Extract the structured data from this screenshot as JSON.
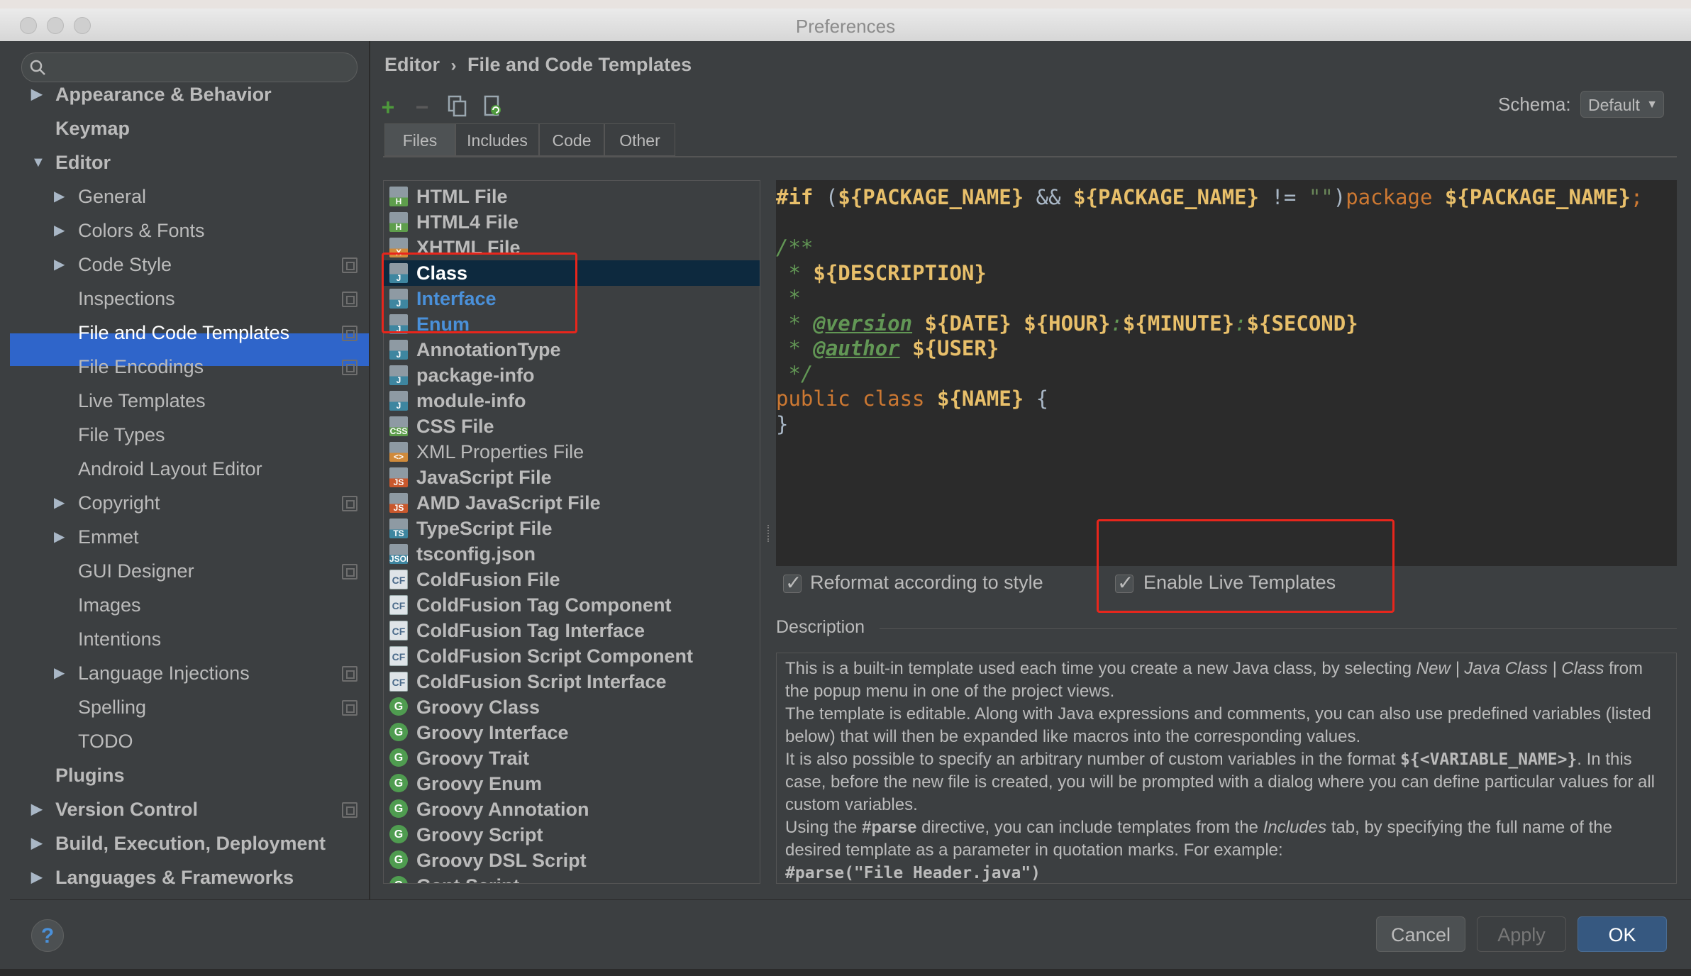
{
  "window": {
    "title": "Preferences"
  },
  "search": {
    "placeholder": ""
  },
  "sidebar": {
    "items": [
      {
        "label": "Appearance & Behavior",
        "level": 0,
        "bold": true,
        "arrow": "collapsed",
        "copy": false
      },
      {
        "label": "Keymap",
        "level": 0,
        "bold": true,
        "arrow": "none",
        "copy": false
      },
      {
        "label": "Editor",
        "level": 0,
        "bold": true,
        "arrow": "expanded",
        "copy": false
      },
      {
        "label": "General",
        "level": 1,
        "bold": false,
        "arrow": "collapsed",
        "copy": false
      },
      {
        "label": "Colors & Fonts",
        "level": 1,
        "bold": false,
        "arrow": "collapsed",
        "copy": false
      },
      {
        "label": "Code Style",
        "level": 1,
        "bold": false,
        "arrow": "collapsed",
        "copy": true
      },
      {
        "label": "Inspections",
        "level": 1,
        "bold": false,
        "arrow": "none",
        "copy": true
      },
      {
        "label": "File and Code Templates",
        "level": 1,
        "bold": false,
        "arrow": "none",
        "copy": true,
        "selected": true
      },
      {
        "label": "File Encodings",
        "level": 1,
        "bold": false,
        "arrow": "none",
        "copy": true
      },
      {
        "label": "Live Templates",
        "level": 1,
        "bold": false,
        "arrow": "none",
        "copy": false
      },
      {
        "label": "File Types",
        "level": 1,
        "bold": false,
        "arrow": "none",
        "copy": false
      },
      {
        "label": "Android Layout Editor",
        "level": 1,
        "bold": false,
        "arrow": "none",
        "copy": false
      },
      {
        "label": "Copyright",
        "level": 1,
        "bold": false,
        "arrow": "collapsed",
        "copy": true
      },
      {
        "label": "Emmet",
        "level": 1,
        "bold": false,
        "arrow": "collapsed",
        "copy": false
      },
      {
        "label": "GUI Designer",
        "level": 1,
        "bold": false,
        "arrow": "none",
        "copy": true
      },
      {
        "label": "Images",
        "level": 1,
        "bold": false,
        "arrow": "none",
        "copy": false
      },
      {
        "label": "Intentions",
        "level": 1,
        "bold": false,
        "arrow": "none",
        "copy": false
      },
      {
        "label": "Language Injections",
        "level": 1,
        "bold": false,
        "arrow": "collapsed",
        "copy": true
      },
      {
        "label": "Spelling",
        "level": 1,
        "bold": false,
        "arrow": "none",
        "copy": true
      },
      {
        "label": "TODO",
        "level": 1,
        "bold": false,
        "arrow": "none",
        "copy": false
      },
      {
        "label": "Plugins",
        "level": 0,
        "bold": true,
        "arrow": "none",
        "copy": false
      },
      {
        "label": "Version Control",
        "level": 0,
        "bold": true,
        "arrow": "collapsed",
        "copy": true
      },
      {
        "label": "Build, Execution, Deployment",
        "level": 0,
        "bold": true,
        "arrow": "collapsed",
        "copy": false
      },
      {
        "label": "Languages & Frameworks",
        "level": 0,
        "bold": true,
        "arrow": "collapsed",
        "copy": false
      }
    ]
  },
  "breadcrumb": {
    "parent": "Editor",
    "separator": "›",
    "current": "File and Code Templates"
  },
  "toolbar": {
    "add_icon": "plus-icon",
    "remove_icon": "minus-icon",
    "copy_icon": "copy-icon",
    "reset_icon": "reset-icon"
  },
  "schema": {
    "label": "Schema:",
    "value": "Default"
  },
  "tabs": [
    {
      "label": "Files",
      "active": true
    },
    {
      "label": "Includes",
      "active": false
    },
    {
      "label": "Code",
      "active": false
    },
    {
      "label": "Other",
      "active": false
    }
  ],
  "files": [
    {
      "label": "HTML File",
      "icon": "html-file-icon",
      "badge": "H",
      "color": "#5e9e4c"
    },
    {
      "label": "HTML4 File",
      "icon": "html-file-icon",
      "badge": "H",
      "color": "#5e9e4c"
    },
    {
      "label": "XHTML File",
      "icon": "xhtml-file-icon",
      "badge": "X",
      "color": "#d08a3a"
    },
    {
      "label": "Class",
      "icon": "java-file-icon",
      "badge": "J",
      "color": "#3e86a0",
      "selected": true
    },
    {
      "label": "Interface",
      "icon": "java-file-icon",
      "badge": "J",
      "color": "#3e86a0",
      "highlight": "#4a90d9"
    },
    {
      "label": "Enum",
      "icon": "java-file-icon",
      "badge": "J",
      "color": "#3e86a0",
      "highlight": "#4a90d9"
    },
    {
      "label": "AnnotationType",
      "icon": "java-file-icon",
      "badge": "J",
      "color": "#3e86a0"
    },
    {
      "label": "package-info",
      "icon": "java-file-icon",
      "badge": "J",
      "color": "#3e86a0"
    },
    {
      "label": "module-info",
      "icon": "java-file-icon",
      "badge": "J",
      "color": "#3e86a0"
    },
    {
      "label": "CSS File",
      "icon": "css-file-icon",
      "badge": "CSS",
      "color": "#5e9e4c"
    },
    {
      "label": "XML Properties File",
      "icon": "xml-file-icon",
      "badge": "<>",
      "color": "#d08a3a",
      "normal": true
    },
    {
      "label": "JavaScript File",
      "icon": "js-file-icon",
      "badge": "JS",
      "color": "#c9582d"
    },
    {
      "label": "AMD JavaScript File",
      "icon": "js-file-icon",
      "badge": "JS",
      "color": "#c9582d"
    },
    {
      "label": "TypeScript File",
      "icon": "ts-file-icon",
      "badge": "TS",
      "color": "#3e86a0"
    },
    {
      "label": "tsconfig.json",
      "icon": "json-file-icon",
      "badge": "JSON",
      "color": "#3e86a0"
    },
    {
      "label": "ColdFusion File",
      "icon": "coldfusion-icon",
      "badge": "CF",
      "color": ""
    },
    {
      "label": "ColdFusion Tag Component",
      "icon": "coldfusion-icon",
      "badge": "CF",
      "color": ""
    },
    {
      "label": "ColdFusion Tag Interface",
      "icon": "coldfusion-icon",
      "badge": "CF",
      "color": ""
    },
    {
      "label": "ColdFusion Script Component",
      "icon": "coldfusion-icon",
      "badge": "CF",
      "color": ""
    },
    {
      "label": "ColdFusion Script Interface",
      "icon": "coldfusion-icon",
      "badge": "CF",
      "color": ""
    },
    {
      "label": "Groovy Class",
      "icon": "groovy-icon",
      "badge": "G",
      "color": ""
    },
    {
      "label": "Groovy Interface",
      "icon": "groovy-icon",
      "badge": "G",
      "color": ""
    },
    {
      "label": "Groovy Trait",
      "icon": "groovy-icon",
      "badge": "G",
      "color": ""
    },
    {
      "label": "Groovy Enum",
      "icon": "groovy-icon",
      "badge": "G",
      "color": ""
    },
    {
      "label": "Groovy Annotation",
      "icon": "groovy-icon",
      "badge": "G",
      "color": ""
    },
    {
      "label": "Groovy Script",
      "icon": "groovy-icon",
      "badge": "G",
      "color": ""
    },
    {
      "label": "Groovy DSL Script",
      "icon": "groovy-icon",
      "badge": "G",
      "color": ""
    },
    {
      "label": "Gant Script",
      "icon": "groovy-icon",
      "badge": "G",
      "color": ""
    }
  ],
  "editor": {
    "lines": [
      [
        [
          "var",
          "#if"
        ],
        [
          "fg",
          " ("
        ],
        [
          "var",
          "${PACKAGE_NAME}"
        ],
        [
          "fg",
          " && "
        ],
        [
          "var",
          "${PACKAGE_NAME}"
        ],
        [
          "fg",
          " != "
        ],
        [
          "str",
          "\"\""
        ],
        [
          "fg",
          ")"
        ],
        [
          "kw-n",
          "package"
        ],
        [
          "fg",
          " "
        ],
        [
          "var",
          "${PACKAGE_NAME}"
        ],
        [
          "kw-n",
          ";"
        ]
      ],
      [],
      [
        [
          "cmt",
          "/**"
        ]
      ],
      [
        [
          "cmt",
          " * "
        ],
        [
          "var",
          "${DESCRIPTION}"
        ]
      ],
      [
        [
          "cmt",
          " *"
        ]
      ],
      [
        [
          "cmt",
          " * "
        ],
        [
          "cmt-tag",
          "@version"
        ],
        [
          "fg",
          " "
        ],
        [
          "var",
          "${DATE}"
        ],
        [
          "fg",
          " "
        ],
        [
          "var",
          "${HOUR}"
        ],
        [
          "cmt",
          ":"
        ],
        [
          "var",
          "${MINUTE}"
        ],
        [
          "cmt",
          ":"
        ],
        [
          "var",
          "${SECOND}"
        ]
      ],
      [
        [
          "cmt",
          " * "
        ],
        [
          "cmt-tag",
          "@author"
        ],
        [
          "fg",
          " "
        ],
        [
          "var",
          "${USER}"
        ]
      ],
      [
        [
          "cmt",
          " */"
        ]
      ],
      [
        [
          "kw-n",
          "public class "
        ],
        [
          "var",
          "${NAME}"
        ],
        [
          "fg",
          " {"
        ]
      ],
      [
        [
          "fg",
          "}"
        ]
      ]
    ]
  },
  "options": {
    "reformat": {
      "label": "Reformat according to style",
      "checked": true
    },
    "live_templates": {
      "label": "Enable Live Templates",
      "checked": true
    }
  },
  "description": {
    "title": "Description",
    "paragraphs": [
      [
        [
          "t",
          "This is a built-in template used each time you create a new Java class, by selecting "
        ],
        [
          "i",
          "New | Java Class | Class"
        ],
        [
          "t",
          " from the popup menu in one of the project views."
        ]
      ],
      [
        [
          "t",
          "The template is editable. Along with Java expressions and comments, you can also use predefined variables (listed below) that will then be expanded like macros into the corresponding values."
        ]
      ],
      [
        [
          "t",
          "It is also possible to specify an arbitrary number of custom variables in the format "
        ],
        [
          "m",
          "${<VARIABLE_NAME>}"
        ],
        [
          "t",
          ". In this case, before the new file is created, you will be prompted with a dialog where you can define particular values for all custom variables."
        ]
      ],
      [
        [
          "t",
          "Using the "
        ],
        [
          "b",
          "#parse"
        ],
        [
          "t",
          " directive, you can include templates from the "
        ],
        [
          "i",
          "Includes"
        ],
        [
          "t",
          " tab, by specifying the full name of the desired template as a parameter in quotation marks. For example:"
        ]
      ],
      [
        [
          "m",
          "#parse(\"File Header.java\")"
        ]
      ]
    ]
  },
  "buttons": {
    "help": "?",
    "cancel": "Cancel",
    "apply": "Apply",
    "ok": "OK"
  },
  "colors": {
    "accent": "#2f65ca",
    "annotation": "#e8261c",
    "ok_button": "#365880"
  }
}
